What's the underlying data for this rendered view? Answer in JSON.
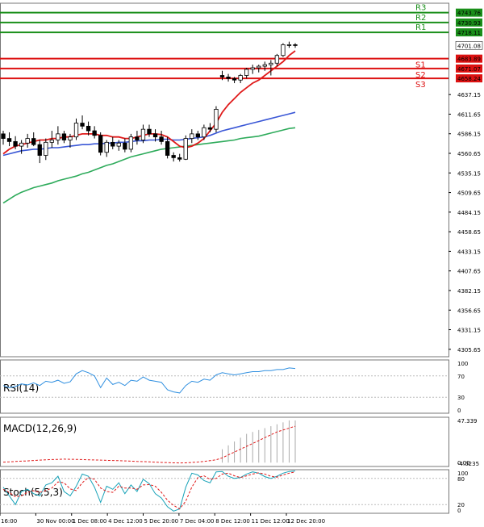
{
  "chart_data": {
    "type": "candlestick",
    "price_axis": {
      "range": [
        4296,
        4756
      ],
      "ticks": [
        "4637.15",
        "4611.65",
        "4586.15",
        "4560.65",
        "4535.15",
        "4509.65",
        "4484.15",
        "4458.65",
        "4433.15",
        "4407.65",
        "4382.15",
        "4356.65",
        "4331.15",
        "4305.65"
      ]
    },
    "time_axis": {
      "labels": [
        "16:00",
        "30 Nov 00:00",
        "1 Dec 08:00",
        "4 Dec 12:00",
        "5 Dec 20:00",
        "7 Dec 04:00",
        "8 Dec 12:00",
        "11 Dec 12:00",
        "12 Dec 20:00"
      ]
    },
    "levels": {
      "resistance": [
        {
          "name": "R1",
          "price": 4718.11,
          "tag": "4718.11"
        },
        {
          "name": "R2",
          "price": 4730.93,
          "tag": "4730.93"
        },
        {
          "name": "R3",
          "price": 4743.76,
          "tag": "4743.76"
        }
      ],
      "support": [
        {
          "name": "S1",
          "price": 4683.89,
          "tag": "4683.89"
        },
        {
          "name": "S2",
          "price": 4671.07,
          "tag": "4671.07"
        },
        {
          "name": "S3",
          "price": 4658.24,
          "tag": "4658.24"
        }
      ],
      "current": {
        "price": 4701.08,
        "tag": "4701.08"
      }
    },
    "candles": [
      [
        4586,
        4590,
        4572,
        4580
      ],
      [
        4580,
        4588,
        4570,
        4576
      ],
      [
        4576,
        4583,
        4566,
        4570
      ],
      [
        4570,
        4578,
        4560,
        4574
      ],
      [
        4574,
        4586,
        4568,
        4580
      ],
      [
        4580,
        4588,
        4570,
        4572
      ],
      [
        4572,
        4578,
        4548,
        4558
      ],
      [
        4558,
        4580,
        4552,
        4575
      ],
      [
        4575,
        4590,
        4568,
        4578
      ],
      [
        4578,
        4596,
        4572,
        4586
      ],
      [
        4586,
        4590,
        4574,
        4578
      ],
      [
        4578,
        4586,
        4568,
        4582
      ],
      [
        4582,
        4606,
        4578,
        4600
      ],
      [
        4600,
        4610,
        4592,
        4596
      ],
      [
        4596,
        4602,
        4584,
        4590
      ],
      [
        4590,
        4596,
        4580,
        4584
      ],
      [
        4584,
        4588,
        4558,
        4562
      ],
      [
        4562,
        4578,
        4556,
        4575
      ],
      [
        4575,
        4582,
        4566,
        4570
      ],
      [
        4570,
        4578,
        4564,
        4574
      ],
      [
        4574,
        4580,
        4562,
        4566
      ],
      [
        4566,
        4586,
        4562,
        4582
      ],
      [
        4582,
        4590,
        4572,
        4578
      ],
      [
        4578,
        4598,
        4574,
        4592
      ],
      [
        4592,
        4598,
        4582,
        4586
      ],
      [
        4586,
        4592,
        4576,
        4582
      ],
      [
        4582,
        4590,
        4572,
        4576
      ],
      [
        4576,
        4582,
        4554,
        4558
      ],
      [
        4558,
        4562,
        4550,
        4555
      ],
      [
        4555,
        4560,
        4550,
        4553
      ],
      [
        4553,
        4584,
        4552,
        4580
      ],
      [
        4580,
        4592,
        4574,
        4586
      ],
      [
        4586,
        4590,
        4578,
        4582
      ],
      [
        4582,
        4598,
        4578,
        4594
      ],
      [
        4594,
        4600,
        4588,
        4592
      ],
      [
        4592,
        4622,
        4588,
        4618
      ],
      [
        4662,
        4668,
        4656,
        4660
      ],
      [
        4660,
        4664,
        4654,
        4658
      ],
      [
        4658,
        4660,
        4652,
        4656
      ],
      [
        4656,
        4664,
        4652,
        4662
      ],
      [
        4662,
        4672,
        4658,
        4670
      ],
      [
        4670,
        4676,
        4664,
        4672
      ],
      [
        4672,
        4676,
        4666,
        4674
      ],
      [
        4674,
        4680,
        4668,
        4676
      ],
      [
        4676,
        4682,
        4662,
        4678
      ],
      [
        4678,
        4690,
        4674,
        4688
      ],
      [
        4688,
        4704,
        4686,
        4702
      ],
      [
        4702,
        4706,
        4698,
        4702
      ],
      [
        4702,
        4704,
        4698,
        4701
      ]
    ],
    "ma_red": [
      4560,
      4566,
      4570,
      4572,
      4574,
      4576,
      4578,
      4578,
      4580,
      4580,
      4582,
      4582,
      4584,
      4586,
      4586,
      4586,
      4584,
      4584,
      4582,
      4582,
      4580,
      4580,
      4582,
      4584,
      4586,
      4586,
      4585,
      4582,
      4576,
      4570,
      4568,
      4570,
      4574,
      4580,
      4590,
      4600,
      4614,
      4624,
      4632,
      4640,
      4646,
      4652,
      4656,
      4662,
      4668,
      4674,
      4680,
      4688,
      4694
    ],
    "ma_blue": [
      4558,
      4560,
      4562,
      4564,
      4565,
      4566,
      4566,
      4567,
      4568,
      4568,
      4569,
      4570,
      4571,
      4572,
      4572,
      4573,
      4573,
      4574,
      4574,
      4575,
      4575,
      4576,
      4577,
      4577,
      4578,
      4578,
      4579,
      4579,
      4578,
      4578,
      4579,
      4580,
      4581,
      4582,
      4584,
      4587,
      4590,
      4592,
      4594,
      4596,
      4598,
      4600,
      4602,
      4604,
      4606,
      4608,
      4610,
      4612,
      4614
    ],
    "ma_green": [
      4496,
      4501,
      4506,
      4510,
      4513,
      4516,
      4518,
      4520,
      4522,
      4525,
      4527,
      4529,
      4531,
      4534,
      4536,
      4539,
      4542,
      4545,
      4547,
      4550,
      4553,
      4556,
      4558,
      4560,
      4562,
      4564,
      4566,
      4567,
      4568,
      4569,
      4570,
      4571,
      4572,
      4573,
      4574,
      4575,
      4576,
      4577,
      4578,
      4580,
      4581,
      4582,
      4583,
      4585,
      4587,
      4589,
      4591,
      4593,
      4594
    ],
    "rsi": {
      "label": "RSI(14)",
      "ticks": [
        "100",
        "70",
        "30",
        "0"
      ],
      "range": [
        0,
        100
      ],
      "values": [
        52,
        48,
        50,
        55,
        53,
        57,
        52,
        60,
        58,
        62,
        56,
        59,
        74,
        80,
        76,
        70,
        48,
        66,
        54,
        58,
        52,
        62,
        60,
        68,
        62,
        60,
        58,
        44,
        40,
        38,
        52,
        60,
        58,
        64,
        62,
        72,
        76,
        74,
        72,
        74,
        76,
        78,
        78,
        80,
        80,
        82,
        82,
        85,
        84
      ]
    },
    "macd": {
      "label": "MACD(12,26,9)",
      "ticks": [
        "47.339",
        "0.00",
        "-4.0235"
      ],
      "range": [
        -4.0235,
        47.339
      ],
      "hist": [
        0,
        0,
        0,
        0,
        0,
        0,
        0,
        0,
        0,
        0,
        0,
        0,
        0,
        0,
        0,
        0,
        0,
        0,
        0,
        0,
        0,
        0,
        0,
        0,
        0,
        0,
        0,
        0,
        0,
        0,
        0,
        0,
        0,
        0,
        0,
        0,
        14,
        18,
        22,
        26,
        30,
        32,
        34,
        36,
        38,
        40,
        42,
        44,
        44
      ],
      "signal": [
        0.5,
        0.8,
        1.2,
        1.5,
        1.8,
        2.2,
        2.6,
        3,
        3.2,
        3.4,
        3.6,
        3.5,
        3.4,
        3.2,
        3,
        2.8,
        2.6,
        2.4,
        2.2,
        2,
        1.8,
        1.5,
        1.2,
        1,
        0.8,
        0.5,
        0.2,
        0,
        -0.2,
        -0.3,
        -0.2,
        0.2,
        0.6,
        1.2,
        2,
        3,
        5,
        8,
        11,
        14,
        17,
        20,
        23,
        26,
        29,
        32,
        34,
        36,
        38
      ]
    },
    "stoch": {
      "label": "Stoch(5,5,3)",
      "ticks": [
        "100",
        "80",
        "20",
        "0"
      ],
      "range": [
        0,
        100
      ],
      "k": [
        60,
        40,
        20,
        50,
        55,
        45,
        40,
        65,
        70,
        85,
        50,
        40,
        62,
        90,
        85,
        60,
        25,
        62,
        55,
        70,
        45,
        65,
        50,
        78,
        68,
        45,
        35,
        15,
        5,
        10,
        60,
        92,
        88,
        75,
        70,
        95,
        96,
        85,
        80,
        82,
        90,
        95,
        92,
        84,
        80,
        85,
        92,
        96,
        97
      ],
      "d": [
        55,
        48,
        38,
        40,
        48,
        52,
        48,
        52,
        58,
        72,
        70,
        56,
        52,
        70,
        82,
        78,
        58,
        50,
        48,
        62,
        58,
        58,
        55,
        65,
        66,
        62,
        48,
        30,
        18,
        10,
        28,
        60,
        82,
        86,
        78,
        80,
        90,
        92,
        86,
        82,
        86,
        90,
        93,
        90,
        85,
        83,
        88,
        92,
        95
      ]
    }
  }
}
